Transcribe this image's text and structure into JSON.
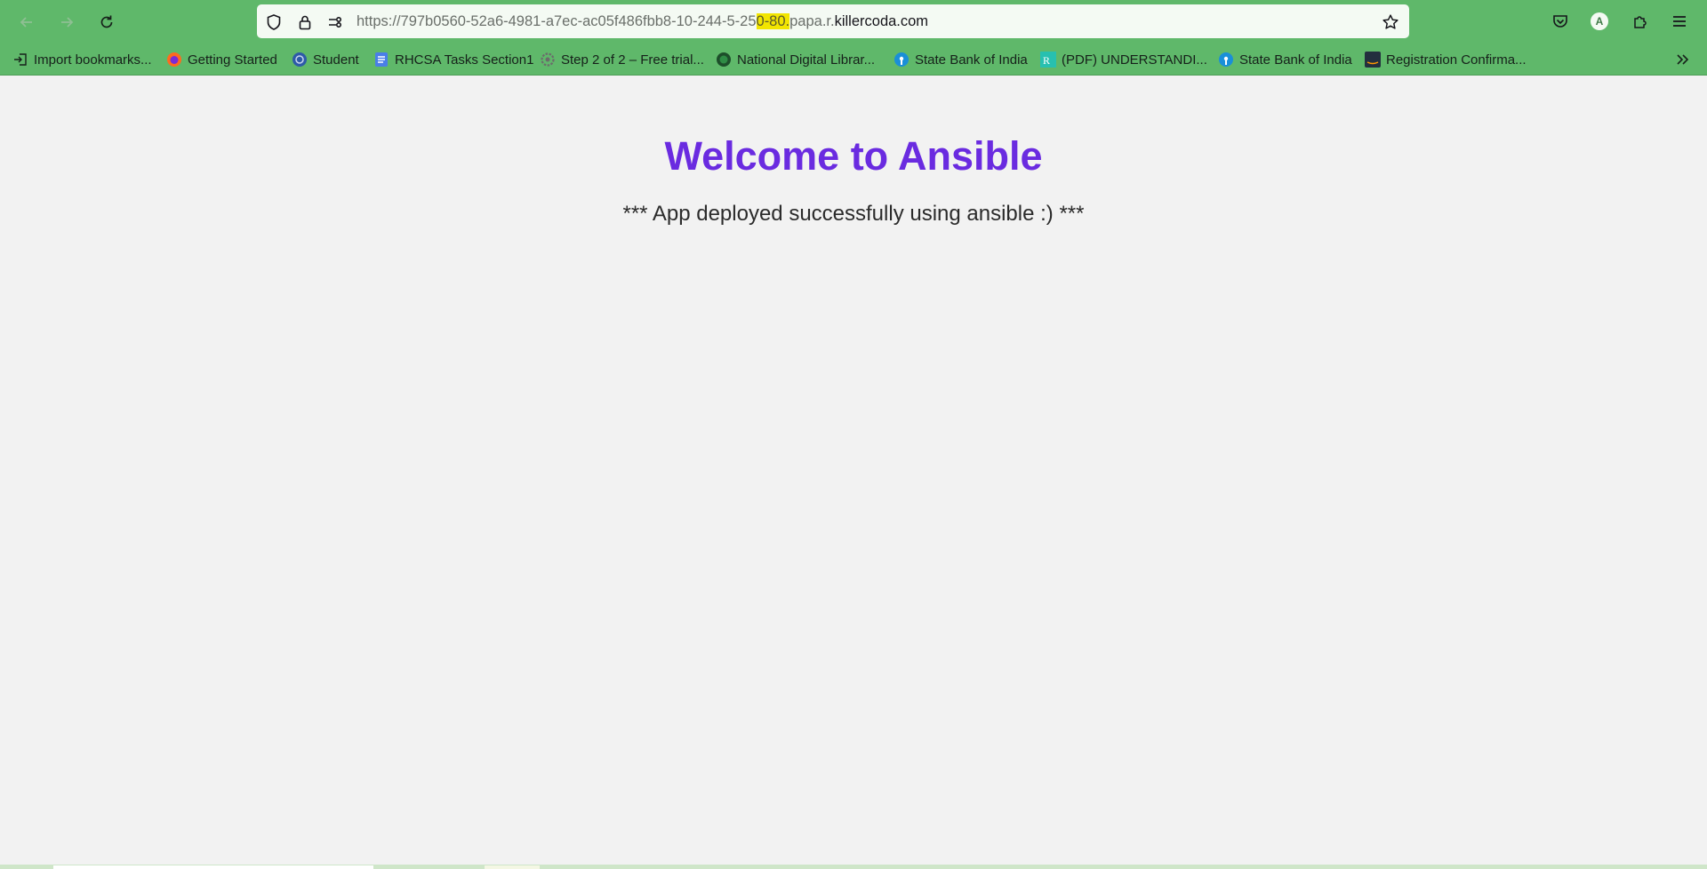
{
  "browser": {
    "url": {
      "prefix": "https://797b0560-52a6-4981-a7ec-ac05f486fbb8-10-244-5-25",
      "highlight": "0-80.",
      "subdomain": "papa.r.",
      "domain": "killercoda.com"
    },
    "profile_initial": "A"
  },
  "bookmarks": [
    {
      "label": "Import bookmarks...",
      "icon": "import-icon"
    },
    {
      "label": "Getting Started",
      "icon": "firefox-icon"
    },
    {
      "label": "Student",
      "icon": "emblem-icon"
    },
    {
      "label": "RHCSA Tasks Section1",
      "icon": "docs-icon"
    },
    {
      "label": "Step 2 of 2 – Free trial...",
      "icon": "gear-icon"
    },
    {
      "label": "National Digital Librar...",
      "icon": "library-icon"
    },
    {
      "label": "State Bank of India",
      "icon": "sbi-icon"
    },
    {
      "label": "(PDF) UNDERSTANDI...",
      "icon": "researchgate-icon"
    },
    {
      "label": "State Bank of India",
      "icon": "sbi-icon"
    },
    {
      "label": "Registration Confirma...",
      "icon": "aws-icon"
    }
  ],
  "page": {
    "title": "Welcome to Ansible",
    "message": "*** App deployed successfully using ansible :) ***"
  },
  "colors": {
    "toolbar": "#5fb86a",
    "title": "#6a2be0",
    "background": "#f2f2f2"
  }
}
